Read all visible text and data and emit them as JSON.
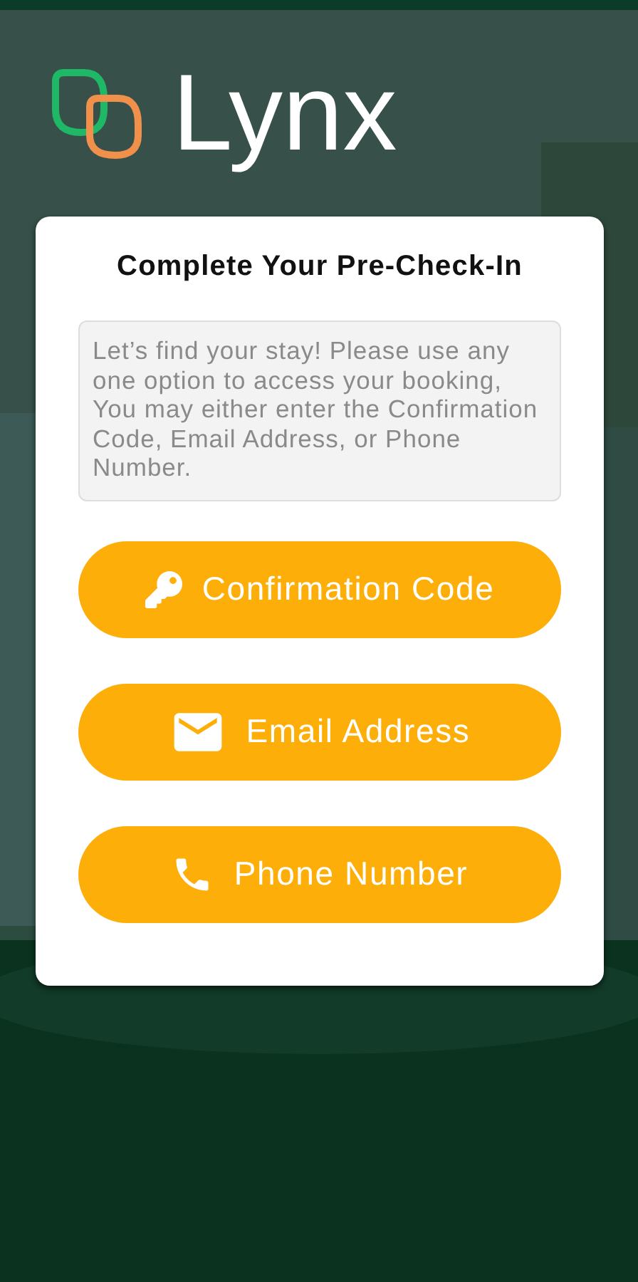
{
  "brand": {
    "name": "Lynx"
  },
  "card": {
    "title": "Complete Your Pre-Check-In",
    "info": "Let’s find your stay! Please use any one option to access your booking, You may either enter the Confirmation Code, Email Address, or Phone Number."
  },
  "options": [
    {
      "kind": "key",
      "label": "Confirmation Code"
    },
    {
      "kind": "email",
      "label": "Email Address"
    },
    {
      "kind": "phone",
      "label": "Phone Number"
    }
  ]
}
